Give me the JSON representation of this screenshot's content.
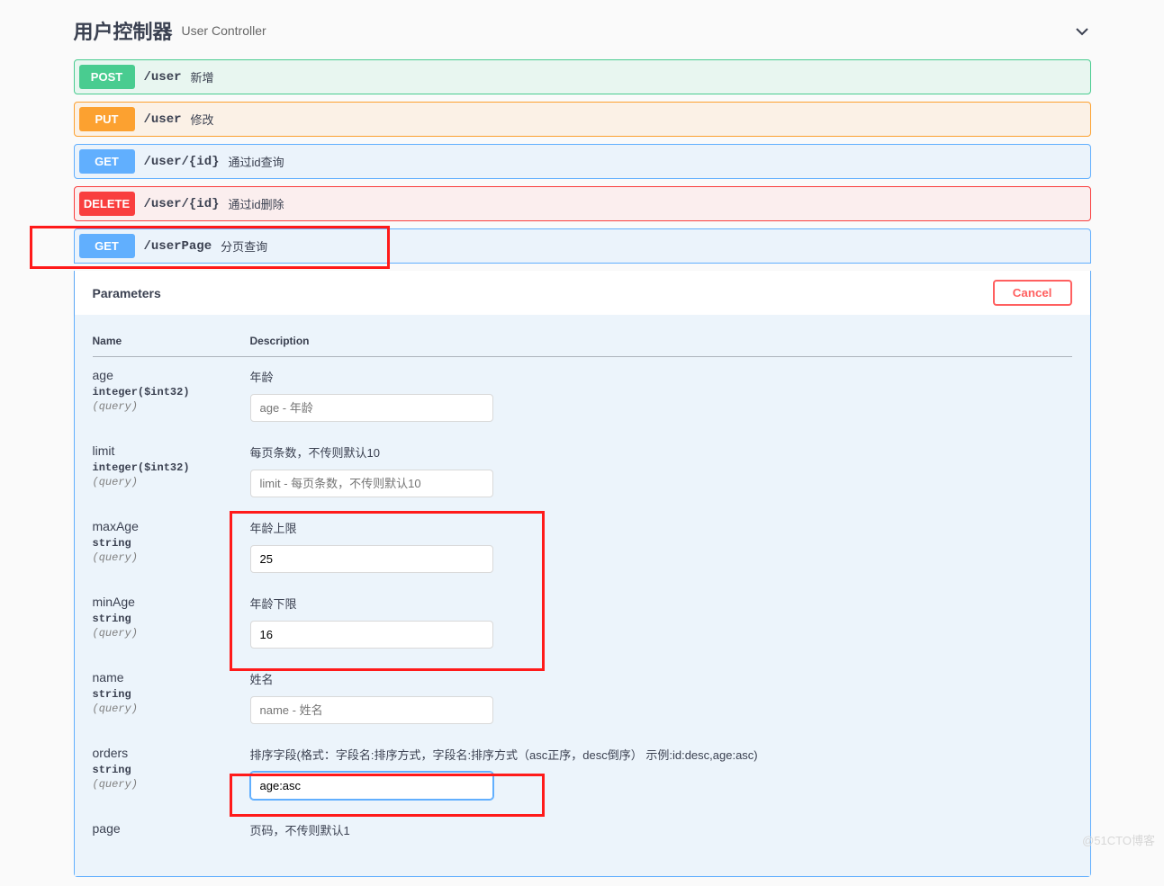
{
  "tag": {
    "title": "用户控制器",
    "subtitle": "User Controller"
  },
  "ops": [
    {
      "method": "POST",
      "path": "/user",
      "desc": "新增"
    },
    {
      "method": "PUT",
      "path": "/user",
      "desc": "修改"
    },
    {
      "method": "GET",
      "path": "/user/{id}",
      "desc": "通过id查询"
    },
    {
      "method": "DELETE",
      "path": "/user/{id}",
      "desc": "通过id删除"
    },
    {
      "method": "GET",
      "path": "/userPage",
      "desc": "分页查询"
    }
  ],
  "params_section": {
    "title": "Parameters",
    "cancel": "Cancel",
    "col_name": "Name",
    "col_desc": "Description"
  },
  "params": [
    {
      "name": "age",
      "type": "integer($int32)",
      "in": "(query)",
      "desc": "年龄",
      "value": "",
      "placeholder": "age - 年龄"
    },
    {
      "name": "limit",
      "type": "integer($int32)",
      "in": "(query)",
      "desc": "每页条数，不传则默认10",
      "value": "",
      "placeholder": "limit - 每页条数，不传则默认10"
    },
    {
      "name": "maxAge",
      "type": "string",
      "in": "(query)",
      "desc": "年龄上限",
      "value": "25",
      "placeholder": ""
    },
    {
      "name": "minAge",
      "type": "string",
      "in": "(query)",
      "desc": "年龄下限",
      "value": "16",
      "placeholder": ""
    },
    {
      "name": "name",
      "type": "string",
      "in": "(query)",
      "desc": "姓名",
      "value": "",
      "placeholder": "name - 姓名"
    },
    {
      "name": "orders",
      "type": "string",
      "in": "(query)",
      "desc": "排序字段(格式：字段名:排序方式，字段名:排序方式（asc正序，desc倒序） 示例:id:desc,age:asc)",
      "value": "age:asc",
      "placeholder": ""
    },
    {
      "name": "page",
      "type": "",
      "in": "",
      "desc": "页码，不传则默认1",
      "value": "",
      "placeholder": ""
    }
  ],
  "watermark": "@51CTO博客"
}
